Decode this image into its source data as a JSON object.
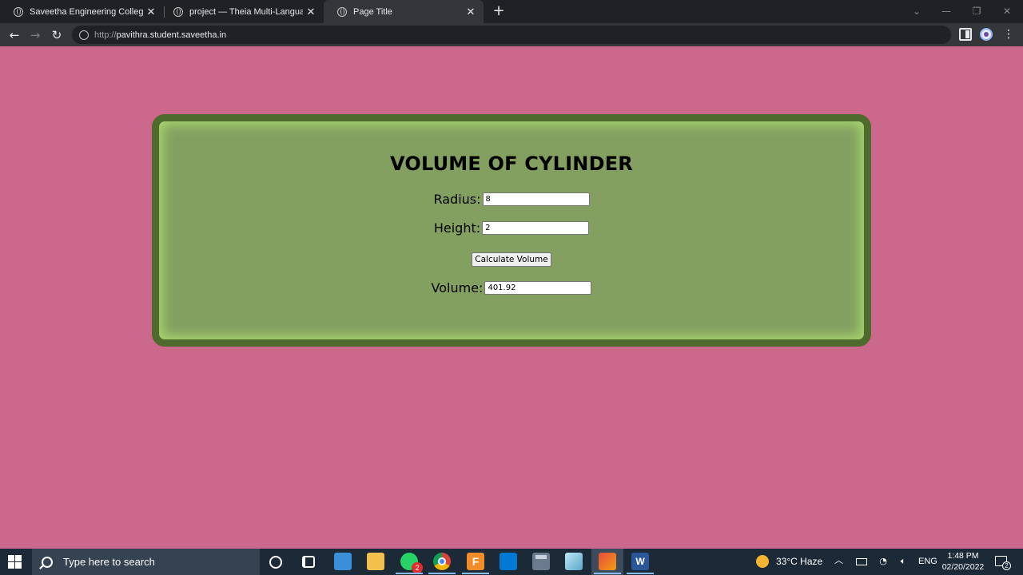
{
  "browser": {
    "tabs": [
      {
        "title": "Saveetha Engineering College",
        "active": false
      },
      {
        "title": "project — Theia Multi-Language",
        "active": false
      },
      {
        "title": "Page Title",
        "active": true
      }
    ],
    "new_tab_label": "+",
    "url_scheme": "http://",
    "url_host": "pavithra.student.saveetha.in",
    "icons": [
      "back-arrow-icon",
      "forward-arrow-icon",
      "reload-icon",
      "site-info-icon",
      "side-panel-icon",
      "profile-icon",
      "menu-icon"
    ]
  },
  "page": {
    "heading": "VOLUME OF CYLINDER",
    "radius_label": "Radius:",
    "radius_value": "8",
    "height_label": "Height:",
    "height_value": "2",
    "button_label": "Calculate Volume",
    "volume_label": "Volume:",
    "volume_value": "401.92",
    "colors": {
      "background": "#cb688b",
      "card_fill": "#83a061",
      "card_border": "#4e6b2d",
      "card_glow": "#a6d36d"
    }
  },
  "taskbar": {
    "search_placeholder": "Type here to search",
    "whatsapp_badge": "2",
    "fapp_letter": "F",
    "word_letter": "W",
    "weather": "33°C  Haze",
    "language": "ENG",
    "time": "1:48 PM",
    "date": "02/20/2022",
    "notification_count": "2"
  }
}
